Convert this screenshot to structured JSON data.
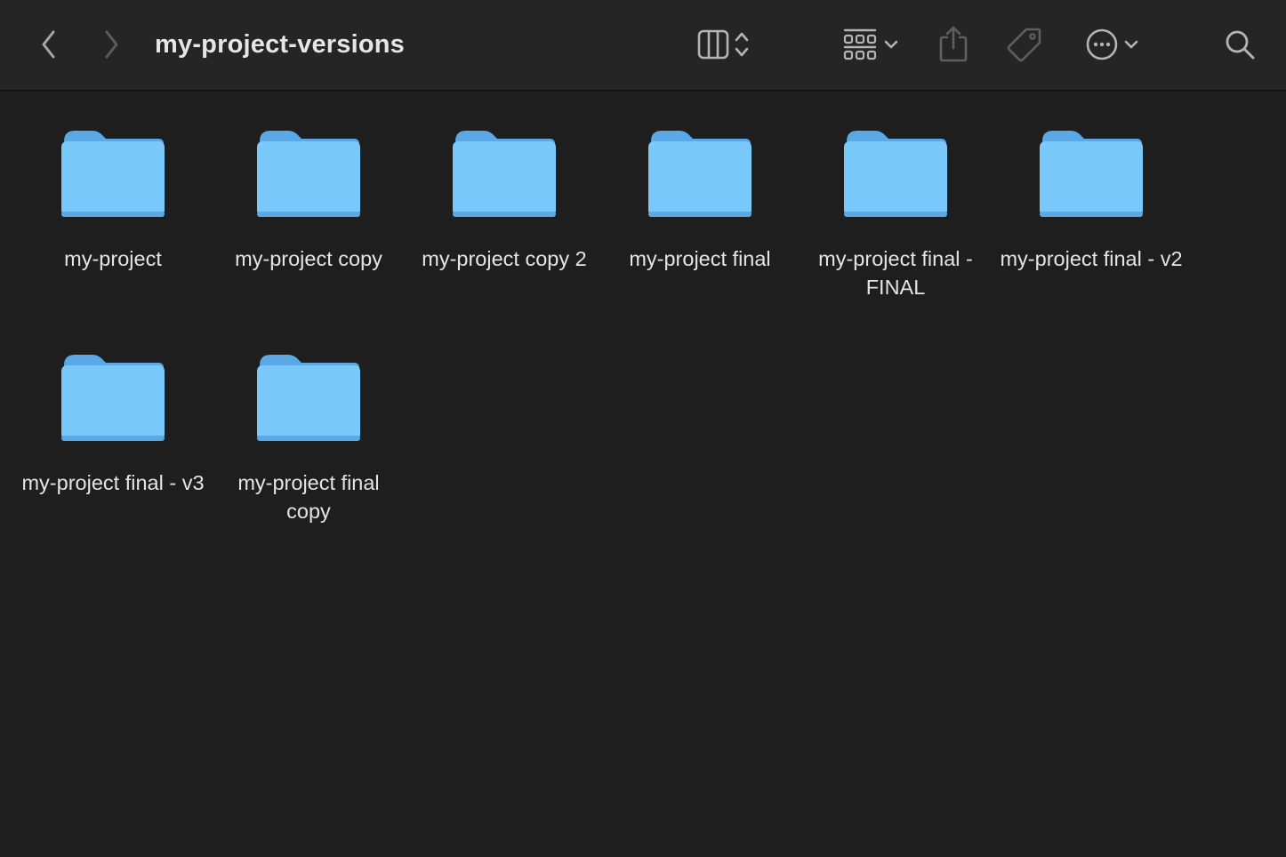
{
  "window": {
    "title": "my-project-versions"
  },
  "toolbar": {
    "icons": {
      "back": "chevron-left-icon",
      "forward": "chevron-right-icon",
      "view_mode": "column-view-icon",
      "view_stepper": "up-down-chevron-icon",
      "group": "grid-group-icon",
      "group_menu": "chevron-down-icon",
      "share": "share-icon",
      "tag": "tag-icon",
      "more": "ellipsis-circle-icon",
      "more_menu": "chevron-down-icon",
      "search": "search-icon"
    }
  },
  "folders": [
    {
      "name": "my-project"
    },
    {
      "name": "my-project copy"
    },
    {
      "name": "my-project copy 2"
    },
    {
      "name": "my-project final"
    },
    {
      "name": "my-project final - FINAL"
    },
    {
      "name": "my-project final - v2"
    },
    {
      "name": "my-project final - v3"
    },
    {
      "name": "my-project final copy"
    }
  ],
  "colors": {
    "background": "#1e1e1e",
    "toolbar": "#252525",
    "folder_front": "#7ac9fb",
    "folder_back": "#5aa9e6",
    "text": "#e4e4e4"
  }
}
